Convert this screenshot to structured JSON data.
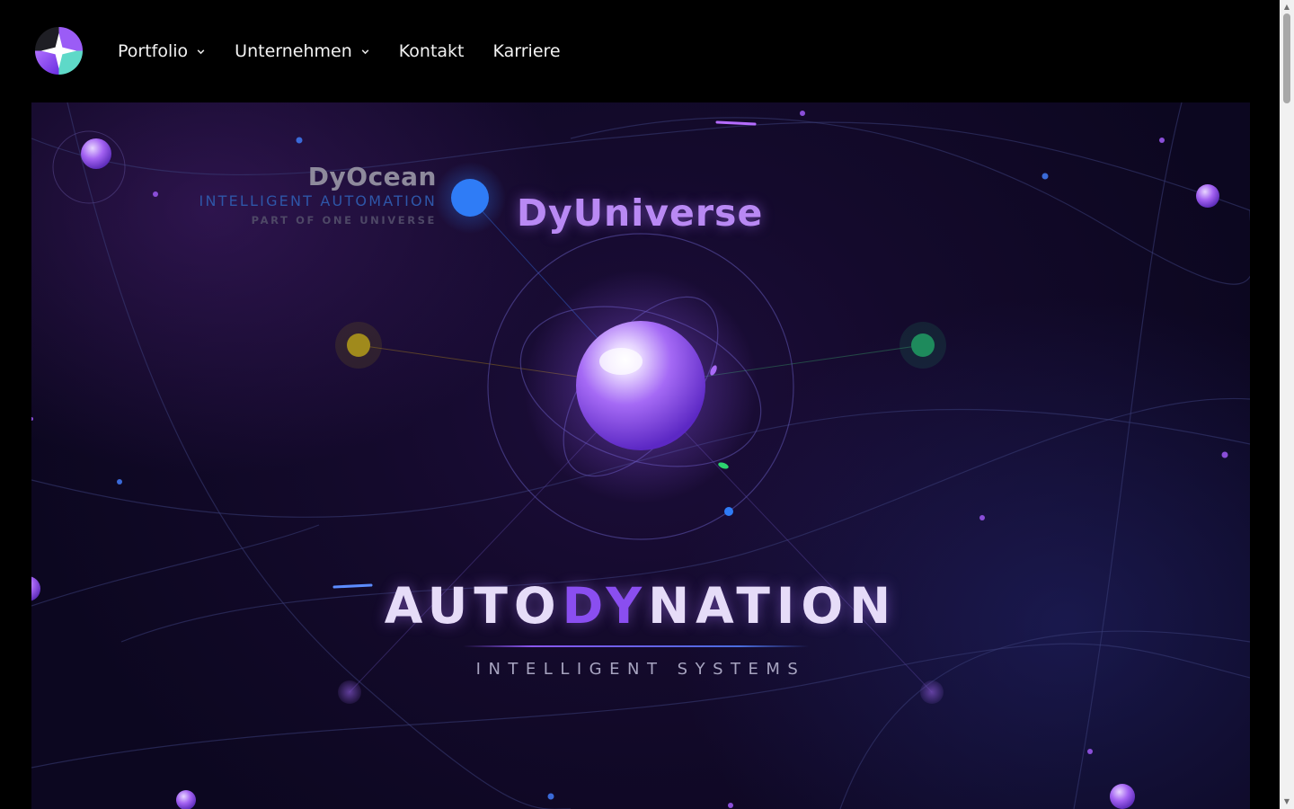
{
  "header": {
    "logo_icon": "star-compass-logo-icon",
    "nav": [
      {
        "label": "Portfolio",
        "has_dropdown": true
      },
      {
        "label": "Unternehmen",
        "has_dropdown": true
      },
      {
        "label": "Kontakt",
        "has_dropdown": false
      },
      {
        "label": "Karriere",
        "has_dropdown": false
      }
    ]
  },
  "hero": {
    "dyocean": {
      "title": "DyOcean",
      "subtitle": "INTELLIGENT AUTOMATION",
      "tagline": "PART OF ONE UNIVERSE"
    },
    "dyuniverse": "DyUniverse",
    "brand": {
      "prefix": "AUTO",
      "highlight": "DY",
      "suffix": "NATION"
    },
    "tagline": "INTELLIGENT SYSTEMS"
  },
  "colors": {
    "accent_purple": "#8a4ef0",
    "accent_blue": "#2f7cf6",
    "orb_yellow": "#a08a1c",
    "orb_green": "#1e8a5c",
    "background": "#0c0720"
  }
}
